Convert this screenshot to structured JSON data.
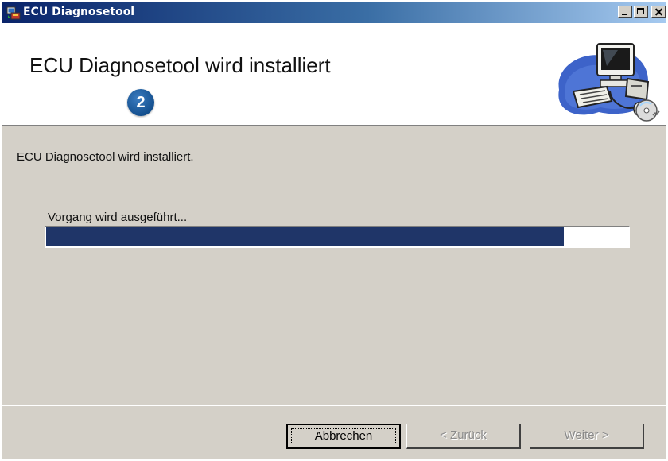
{
  "window": {
    "title": "ECU Diagnosetool",
    "icons": {
      "app": "installer-icon",
      "minimize": "minimize-icon",
      "maximize": "maximize-icon",
      "close": "close-icon"
    }
  },
  "banner": {
    "heading": "ECU Diagnosetool wird installiert",
    "step_badge": "2",
    "graphic": "computer-setup-icon"
  },
  "content": {
    "status_text": "ECU Diagnosetool wird installiert.",
    "progress_label": "Vorgang wird ausgeführt...",
    "progress_fraction": 0.89
  },
  "buttons": {
    "cancel": "Abbrechen",
    "back": "< Zurück",
    "next": "Weiter >"
  },
  "colors": {
    "progress_fill": "#1f3568",
    "titlebar_start": "#0a246a",
    "step_badge": "#14508f"
  }
}
